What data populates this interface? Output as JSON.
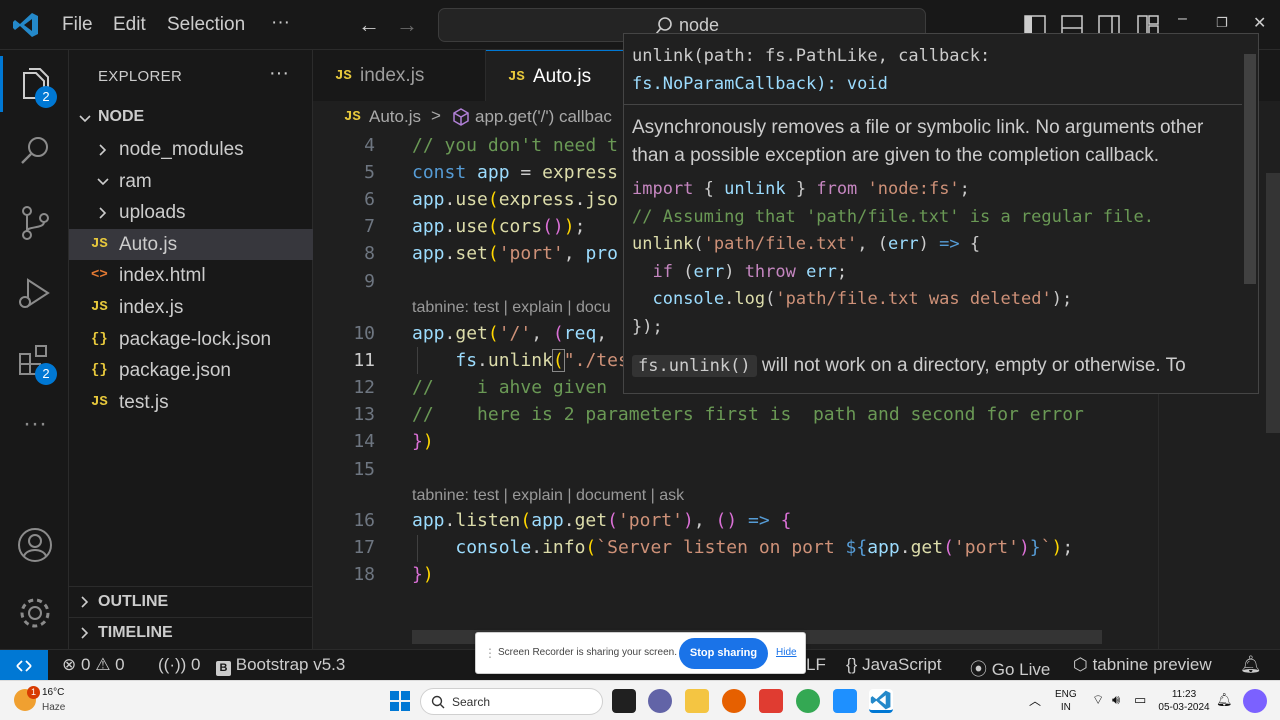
{
  "titlebar": {
    "menu": [
      "File",
      "Edit",
      "Selection",
      "···"
    ],
    "search_text": "node"
  },
  "activity": {
    "explorer_badge": "2",
    "extensions_badge": "2",
    "icons": [
      "files-icon",
      "search-icon",
      "source-control-icon",
      "run-debug-icon",
      "extensions-icon",
      "more-icon",
      "accounts-icon",
      "settings-gear-icon"
    ]
  },
  "sidebar": {
    "title": "EXPLORER",
    "more": "···",
    "root": "NODE",
    "items": [
      {
        "label": "node_modules",
        "type": "folder"
      },
      {
        "label": "ram",
        "type": "folder"
      },
      {
        "label": "uploads",
        "type": "folder"
      },
      {
        "label": "Auto.js",
        "type": "js"
      },
      {
        "label": "index.html",
        "type": "html"
      },
      {
        "label": "index.js",
        "type": "js"
      },
      {
        "label": "package-lock.json",
        "type": "json"
      },
      {
        "label": "package.json",
        "type": "json"
      },
      {
        "label": "test.js",
        "type": "js"
      }
    ],
    "outline": "OUTLINE",
    "timeline": "TIMELINE"
  },
  "tabs": [
    {
      "label": "index.js",
      "badge": "JS",
      "active": false
    },
    {
      "label": "Auto.js",
      "badge": "JS",
      "active": true
    }
  ],
  "breadcrumb": {
    "badge": "JS",
    "file": "Auto.js",
    "separator": ">",
    "symbol": "app.get('/') callbac"
  },
  "editor": {
    "codelens_text": "tabnine: test | explain | document | ask",
    "codelens_text_cut": "tabnine: test | explain | docu",
    "line_numbers": [
      "4",
      "5",
      "6",
      "7",
      "8",
      "9",
      "10",
      "11",
      "12",
      "13",
      "14",
      "15",
      "16",
      "17",
      "18"
    ],
    "visible_code": [
      "// you don't need t",
      "const app = express",
      "app.use(express.jso",
      "app.use(cors());",
      "app.set('port', pro",
      "",
      "app.get('/', (req,",
      "    fs.unlink(\"./tes",
      "//    i ahve given",
      "//    here is 2 parameters first is  path and second for error",
      "})",
      "",
      "app.listen(app.get('port'), () => {",
      "    console.info(`Server listen on port ${app.get('port')}`);",
      "})"
    ]
  },
  "hover": {
    "signature_line1": "unlink(path: fs.PathLike, callback:",
    "signature_line2": "fs.NoParamCallback): void",
    "description": "Asynchronously removes a file or symbolic link. No arguments other than a possible exception are given to the completion callback.",
    "example": [
      "import { unlink } from 'node:fs';",
      "// Assuming that 'path/file.txt' is a regular file.",
      "unlink('path/file.txt', (err) => {",
      "  if (err) throw err;",
      "  console.log('path/file.txt was deleted');",
      "});"
    ],
    "note_code": "fs.unlink()",
    "note_text": "will not work on a directory, empty or otherwise. To"
  },
  "statusbar": {
    "errors": "0",
    "warnings": "0",
    "ports": "0",
    "bootstrap": "Bootstrap v5.3",
    "eol": "LF",
    "language": "JavaScript",
    "golive": "Go Live",
    "tabnine": "tabnine preview"
  },
  "recorder": {
    "text": "Screen Recorder is sharing your screen.",
    "stop": "Stop sharing",
    "hide": "Hide"
  },
  "taskbar": {
    "weather_temp": "16°C",
    "weather_cond": "Haze",
    "weather_badge": "1",
    "search": "Search",
    "lang_line1": "ENG",
    "lang_line2": "IN",
    "time": "11:23",
    "date": "05-03-2024"
  },
  "colors": {
    "accent": "#0078d4",
    "editor_bg": "#1f1f1f",
    "sidebar_bg": "#181818",
    "js_icon": "#e8c93c"
  }
}
